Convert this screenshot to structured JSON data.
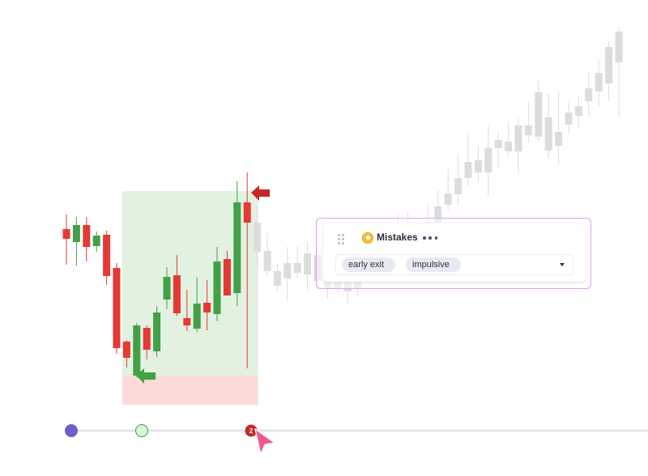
{
  "chart_data": {
    "type": "candlestick",
    "description_units": "price units (unlabeled axis)",
    "candles_active": [
      {
        "o": 282,
        "c": 270,
        "h": 300,
        "l": 238,
        "color": "#e53935"
      },
      {
        "o": 266,
        "c": 287,
        "h": 297,
        "l": 237,
        "color": "#43a047"
      },
      {
        "o": 287,
        "c": 260,
        "h": 297,
        "l": 242,
        "color": "#e53935"
      },
      {
        "o": 261,
        "c": 274,
        "h": 279,
        "l": 254,
        "color": "#43a047"
      },
      {
        "o": 275,
        "c": 224,
        "h": 280,
        "l": 213,
        "color": "#e53935"
      },
      {
        "o": 234,
        "c": 135,
        "h": 240,
        "l": 128,
        "color": "#e53935"
      },
      {
        "o": 143,
        "c": 123,
        "h": 145,
        "l": 111,
        "color": "#e53935"
      },
      {
        "o": 101,
        "c": 163,
        "h": 166,
        "l": 99,
        "color": "#43a047"
      },
      {
        "o": 160,
        "c": 133,
        "h": 163,
        "l": 121,
        "color": "#e53935"
      },
      {
        "o": 131,
        "c": 179,
        "h": 187,
        "l": 124,
        "color": "#43a047"
      },
      {
        "o": 195,
        "c": 223,
        "h": 235,
        "l": 183,
        "color": "#43a047"
      },
      {
        "o": 225,
        "c": 178,
        "h": 250,
        "l": 175,
        "color": "#e53935"
      },
      {
        "o": 172,
        "c": 163,
        "h": 207,
        "l": 156,
        "color": "#e53935"
      },
      {
        "o": 159,
        "c": 190,
        "h": 222,
        "l": 155,
        "color": "#43a047"
      },
      {
        "o": 191,
        "c": 179,
        "h": 219,
        "l": 157,
        "color": "#e53935"
      },
      {
        "o": 177,
        "c": 242,
        "h": 260,
        "l": 168,
        "color": "#43a047"
      },
      {
        "o": 245,
        "c": 200,
        "h": 255,
        "l": 200,
        "color": "#e53935"
      },
      {
        "o": 203,
        "c": 315,
        "h": 341,
        "l": 187,
        "color": "#43a047"
      },
      {
        "o": 315,
        "c": 290,
        "h": 352,
        "l": 110,
        "color": "#e53935"
      }
    ],
    "candles_future": [
      {
        "o": 290,
        "c": 254,
        "h": 309,
        "l": 233
      },
      {
        "o": 255,
        "c": 230,
        "h": 277,
        "l": 224
      },
      {
        "o": 230,
        "c": 212,
        "h": 239,
        "l": 206
      },
      {
        "o": 221,
        "c": 240,
        "h": 260,
        "l": 193
      },
      {
        "o": 240,
        "c": 228,
        "h": 261,
        "l": 221
      },
      {
        "o": 226,
        "c": 252,
        "h": 266,
        "l": 207
      },
      {
        "o": 250,
        "c": 218,
        "h": 260,
        "l": 208
      },
      {
        "o": 218,
        "c": 209,
        "h": 231,
        "l": 196
      },
      {
        "o": 209,
        "c": 225,
        "h": 233,
        "l": 203
      },
      {
        "o": 230,
        "c": 205,
        "h": 242,
        "l": 190
      },
      {
        "o": 208,
        "c": 232,
        "h": 245,
        "l": 200
      },
      {
        "o": 230,
        "c": 252,
        "h": 260,
        "l": 225
      },
      {
        "o": 252,
        "c": 234,
        "h": 264,
        "l": 227
      },
      {
        "o": 232,
        "c": 243,
        "h": 271,
        "l": 227
      },
      {
        "o": 243,
        "c": 250,
        "h": 300,
        "l": 240
      },
      {
        "o": 247,
        "c": 270,
        "h": 303,
        "l": 242
      },
      {
        "o": 268,
        "c": 260,
        "h": 290,
        "l": 258
      },
      {
        "o": 260,
        "c": 290,
        "h": 312,
        "l": 252
      },
      {
        "o": 290,
        "c": 310,
        "h": 330,
        "l": 260
      },
      {
        "o": 312,
        "c": 326,
        "h": 356,
        "l": 305
      },
      {
        "o": 325,
        "c": 345,
        "h": 375,
        "l": 312
      },
      {
        "o": 345,
        "c": 365,
        "h": 401,
        "l": 335
      },
      {
        "o": 367,
        "c": 352,
        "h": 385,
        "l": 340
      },
      {
        "o": 352,
        "c": 382,
        "h": 410,
        "l": 323
      },
      {
        "o": 382,
        "c": 392,
        "h": 402,
        "l": 356
      },
      {
        "o": 390,
        "c": 378,
        "h": 415,
        "l": 372
      },
      {
        "o": 378,
        "c": 410,
        "h": 421,
        "l": 352
      },
      {
        "o": 410,
        "c": 398,
        "h": 439,
        "l": 389
      },
      {
        "o": 396,
        "c": 451,
        "h": 466,
        "l": 391
      },
      {
        "o": 420,
        "c": 379,
        "h": 449,
        "l": 370
      },
      {
        "o": 385,
        "c": 402,
        "h": 452,
        "l": 362
      },
      {
        "o": 411,
        "c": 426,
        "h": 440,
        "l": 399
      },
      {
        "o": 422,
        "c": 434,
        "h": 446,
        "l": 408
      },
      {
        "o": 440,
        "c": 456,
        "h": 476,
        "l": 420
      },
      {
        "o": 452,
        "c": 475,
        "h": 492,
        "l": 434
      },
      {
        "o": 462,
        "c": 507,
        "h": 514,
        "l": 440
      },
      {
        "o": 488,
        "c": 526,
        "h": 531,
        "l": 420
      }
    ],
    "trade_zone": {
      "start_index": 6,
      "end_index": 19,
      "entry_price": 128,
      "exit_price": 270,
      "stop_price": 93,
      "profit_color": "#e3f1e1",
      "loss_color": "#fbdbd8"
    }
  },
  "mistakes_panel": {
    "title": "Mistakes",
    "icon": "bulb-tag-icon",
    "more_icon": "more-horizontal-icon",
    "handle_icon": "drag-handle-icon",
    "tags": [
      "early exit",
      "impulsive"
    ],
    "border_color": "#d8a6e6"
  },
  "timeline": {
    "markers": [
      {
        "name": "timeline-start-marker",
        "color": "#6c5fc7"
      },
      {
        "name": "timeline-entry-marker",
        "color": "#d9f4d6"
      },
      {
        "name": "timeline-exit-marker",
        "color": "#c62828",
        "label": "2"
      }
    ],
    "cursor_icon": "pointer-cursor-icon",
    "cursor_color": "#ef5b8a"
  },
  "arrows": {
    "entry": {
      "icon": "entry-arrow-icon",
      "color": "#43a047"
    },
    "exit": {
      "icon": "exit-arrow-icon",
      "color": "#c62828"
    }
  }
}
